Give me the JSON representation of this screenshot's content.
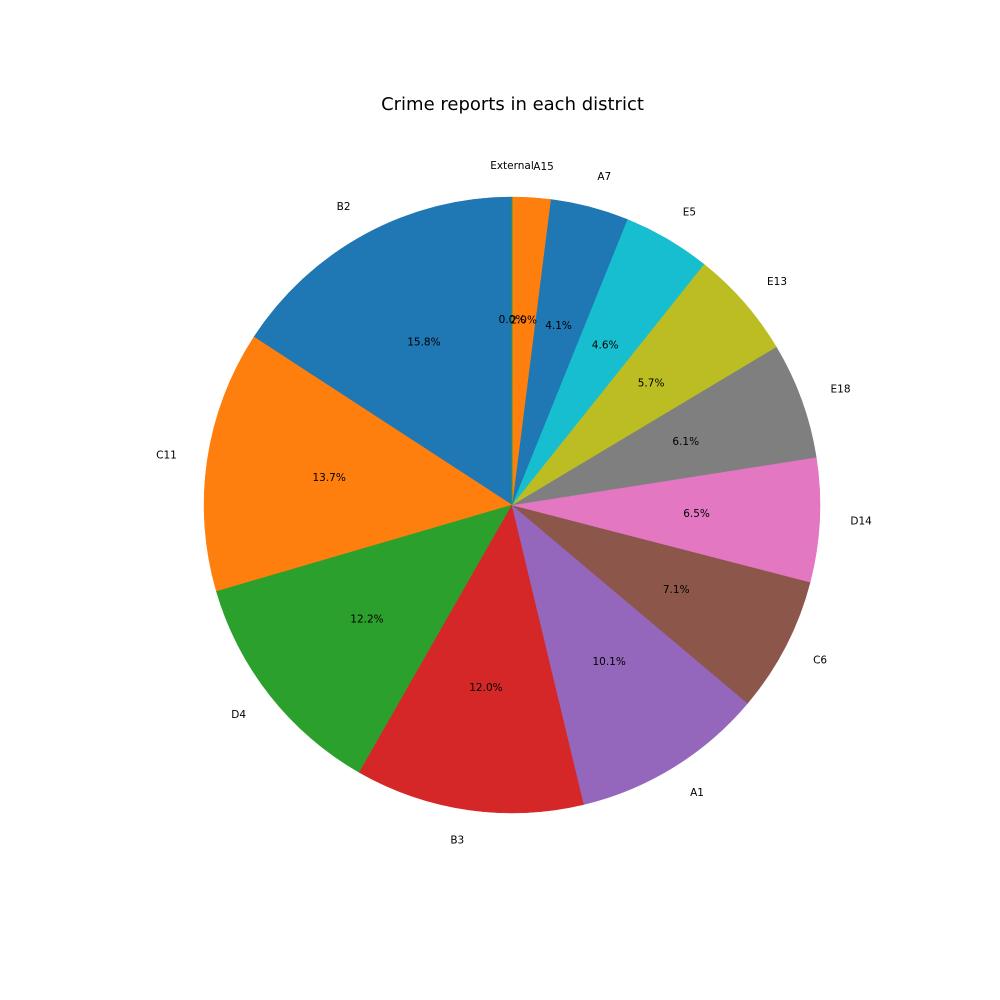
{
  "chart_data": {
    "type": "pie",
    "title": "Crime reports in each district",
    "start_angle": 90,
    "direction": "counterclockwise",
    "categories": [
      "B2",
      "C11",
      "D4",
      "B3",
      "A1",
      "C6",
      "D14",
      "E18",
      "E13",
      "E5",
      "A7",
      "A15",
      "External"
    ],
    "values": [
      15.8,
      13.7,
      12.2,
      12.0,
      10.1,
      7.1,
      6.5,
      6.1,
      5.7,
      4.6,
      4.1,
      2.0,
      0.0
    ],
    "percent_labels": [
      "15.8%",
      "13.7%",
      "12.2%",
      "12.0%",
      "10.1%",
      "7.1%",
      "6.5%",
      "6.1%",
      "5.7%",
      "4.6%",
      "4.1%",
      "2.0%",
      "0.0%"
    ],
    "colors": [
      "#1f77b4",
      "#ff7f0e",
      "#2ca02c",
      "#d62728",
      "#9467bd",
      "#8c564b",
      "#e377c2",
      "#7f7f7f",
      "#bcbd22",
      "#17becf",
      "#1f77b4",
      "#ff7f0e",
      "#2ca02c"
    ]
  }
}
